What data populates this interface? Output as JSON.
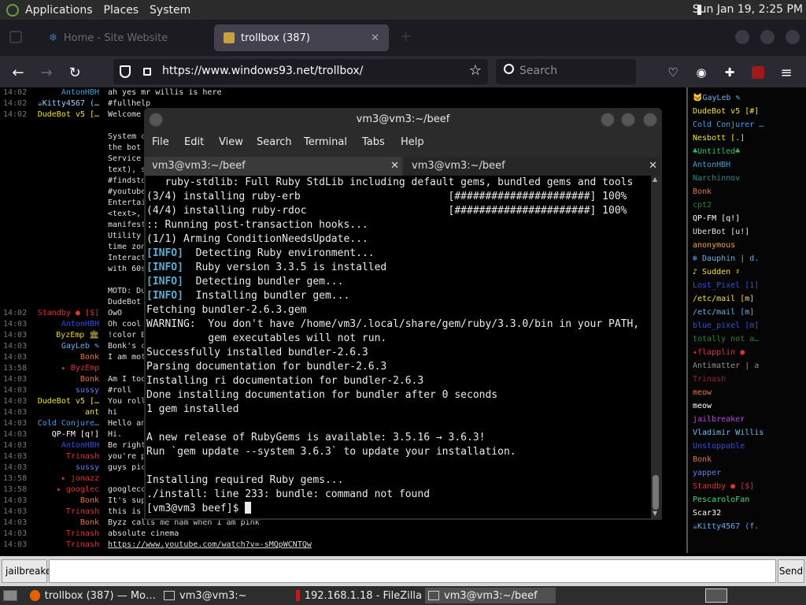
{
  "topbar": {
    "apps": "Applications",
    "places": "Places",
    "system": "System",
    "clock": "Sun Jan 19,  2:25 PM"
  },
  "browser": {
    "tab_inactive": "Home - Site Website",
    "tab_active": "trollbox (387)",
    "url": "https://www.windows93.net/trollbox/",
    "search_placeholder": "Search"
  },
  "chat": {
    "lines": [
      {
        "ts": "14:02",
        "nick": "AntonHBH",
        "color": "#3aa0d8",
        "msg": "ah yes mr willis is here"
      },
      {
        "ts": "14:02",
        "nick": "☕Kitty4567 (…",
        "color": "#9ad0ff",
        "msg": "#fullhelp"
      },
      {
        "ts": "14:02",
        "nick": "DudeBot v5 […",
        "color": "#f0e030",
        "msg": "Welcome to the trollbox…"
      },
      {
        "ts": "",
        "nick": "",
        "color": "#fff",
        "msg": ""
      },
      {
        "ts": "",
        "nick": "",
        "color": "#fff",
        "msg": "System c"
      },
      {
        "ts": "",
        "nick": "",
        "color": "#fff",
        "msg": "the bot"
      },
      {
        "ts": "",
        "nick": "",
        "color": "#fff",
        "msg": "Service"
      },
      {
        "ts": "",
        "nick": "",
        "color": "#fff",
        "msg": "text), s"
      },
      {
        "ts": "",
        "nick": "",
        "color": "#fff",
        "msg": "#findsto"
      },
      {
        "ts": "",
        "nick": "",
        "color": "#fff",
        "msg": "#youtube"
      },
      {
        "ts": "",
        "nick": "",
        "color": "#fff",
        "msg": "Entertai"
      },
      {
        "ts": "",
        "nick": "",
        "color": "#fff",
        "msg": "<text>,"
      },
      {
        "ts": "",
        "nick": "",
        "color": "#fff",
        "msg": "manifest"
      },
      {
        "ts": "",
        "nick": "",
        "color": "#fff",
        "msg": "Utility"
      },
      {
        "ts": "",
        "nick": "",
        "color": "#fff",
        "msg": "time zon"
      },
      {
        "ts": "",
        "nick": "",
        "color": "#fff",
        "msg": "Interact"
      },
      {
        "ts": "",
        "nick": "",
        "color": "#fff",
        "msg": "with 60s"
      },
      {
        "ts": "",
        "nick": "",
        "color": "#fff",
        "msg": ""
      },
      {
        "ts": "",
        "nick": "",
        "color": "#fff",
        "msg": "MOTD: Du"
      },
      {
        "ts": "",
        "nick": "",
        "color": "#fff",
        "msg": "DudeBot"
      },
      {
        "ts": "14:02",
        "nick": "Standby ● [$]",
        "color": "#e03030",
        "msg": "OwO"
      },
      {
        "ts": "14:03",
        "nick": "AntonHBH",
        "color": "#3050e0",
        "msg": "Oh cool"
      },
      {
        "ts": "14:03",
        "nick": "ByzEmp 🏛",
        "color": "#e0d030",
        "msg": "!color B"
      },
      {
        "ts": "14:03",
        "nick": "GayLeb ✎",
        "color": "#60b0f0",
        "msg": "Bonk's c"
      },
      {
        "ts": "14:03",
        "nick": "Bonk",
        "color": "#f07030",
        "msg": "I am mot"
      },
      {
        "ts": "13:58",
        "nick": "▸ ByzEmp",
        "color": "#e03030",
        "msg": ""
      },
      {
        "ts": "14:03",
        "nick": "Bonk",
        "color": "#f07030",
        "msg": "Am I too"
      },
      {
        "ts": "14:03",
        "nick": "sussy",
        "color": "#6080f0",
        "msg": "#roll"
      },
      {
        "ts": "14:03",
        "nick": "DudeBot v5 […",
        "color": "#f0e030",
        "msg": "You roll"
      },
      {
        "ts": "14:03",
        "nick": "ant",
        "color": "#f0e030",
        "msg": "hi"
      },
      {
        "ts": "14:03",
        "nick": "Cold Conjure…",
        "color": "#3aa0f0",
        "msg": "Hello an"
      },
      {
        "ts": "14:03",
        "nick": "QP-FM [q!]",
        "color": "#ffffff",
        "msg": "Hi."
      },
      {
        "ts": "14:03",
        "nick": "AntonHBH",
        "color": "#3050e0",
        "msg": "Be right"
      },
      {
        "ts": "14:03",
        "nick": "Trinash",
        "color": "#e03030",
        "msg": "you're p"
      },
      {
        "ts": "14:03",
        "nick": "sussy",
        "color": "#6080f0",
        "msg": "guys pic"
      },
      {
        "ts": "13:58",
        "nick": "▸ jonazz",
        "color": "#e03030",
        "msg": ""
      },
      {
        "ts": "13:58",
        "nick": "▸ googlec",
        "color": "#e03030",
        "msg": "googleco"
      },
      {
        "ts": "14:03",
        "nick": "Bonk",
        "color": "#f07030",
        "msg": "It's sup"
      },
      {
        "ts": "14:03",
        "nick": "Trinash",
        "color": "#e03030",
        "msg": "this is"
      },
      {
        "ts": "14:03",
        "nick": "Bonk",
        "color": "#f07030",
        "msg": "Byzz calls me ham when I am pink"
      },
      {
        "ts": "14:03",
        "nick": "Trinash",
        "color": "#e03030",
        "msg": "absolute cinema"
      },
      {
        "ts": "14:03",
        "nick": "Trinash",
        "color": "#e03030",
        "msg": "https://www.youtube.com/watch?v=-sMQpWCNTQw"
      }
    ],
    "users": [
      {
        "name": "🐱GayLeb ✎",
        "color": "#60b0f0"
      },
      {
        "name": "DudeBot v5 [#]",
        "color": "#f0e030"
      },
      {
        "name": "Cold Conjurer …",
        "color": "#3aa0f0"
      },
      {
        "name": "Nesbott [.]",
        "color": "#f0e030"
      },
      {
        "name": "♣Untitled♣",
        "color": "#30c060"
      },
      {
        "name": "AntonHBH",
        "color": "#3aa0d8"
      },
      {
        "name": "Narchinnov",
        "color": "#2a8a8a"
      },
      {
        "name": "Bonk",
        "color": "#f07030"
      },
      {
        "name": "cpt2",
        "color": "#308030"
      },
      {
        "name": "QP-FM [q!]",
        "color": "#ffffff"
      },
      {
        "name": "UberBot [u!]",
        "color": "#e0e0e0"
      },
      {
        "name": "anonymous",
        "color": "#f0a030"
      },
      {
        "name": "❄ Dauphin | d.",
        "color": "#60b0f0"
      },
      {
        "name": "♪ Sudden ♯",
        "color": "#f0e030"
      },
      {
        "name": "Lost_Pixel [1]",
        "color": "#3050e0"
      },
      {
        "name": "/etc/mail [m]",
        "color": "#f0e030"
      },
      {
        "name": "/etc/mail [m]",
        "color": "#60b0f0"
      },
      {
        "name": "blue_pixel [m]",
        "color": "#3050e0"
      },
      {
        "name": "totally not a…",
        "color": "#308030"
      },
      {
        "name": "✦flapplin ●",
        "color": "#e03030"
      },
      {
        "name": "Antimatter | a",
        "color": "#909090"
      },
      {
        "name": "Trinash",
        "color": "#a02020"
      },
      {
        "name": "meow",
        "color": "#f07030"
      },
      {
        "name": "meow",
        "color": "#ffffff"
      },
      {
        "name": "jailbreaker",
        "color": "#c040e0"
      },
      {
        "name": "Vladimir Willis",
        "color": "#60c0f0"
      },
      {
        "name": "Unstoppable",
        "color": "#3050e0"
      },
      {
        "name": "Bonk",
        "color": "#f07030"
      },
      {
        "name": "yapper",
        "color": "#6080f0"
      },
      {
        "name": "Standby ● [$]",
        "color": "#e03030"
      },
      {
        "name": "PescaroloFan",
        "color": "#30e080"
      },
      {
        "name": "Scar32",
        "color": "#ffffff"
      },
      {
        "name": "☕Kitty4567 (f.",
        "color": "#60b0f0"
      }
    ],
    "input_nick": "jailbreaker",
    "send": "Send"
  },
  "terminal": {
    "title": "vm3@vm3:~/beef",
    "menu": [
      "File",
      "Edit",
      "View",
      "Search",
      "Terminal",
      "Tabs",
      "Help"
    ],
    "tabs": [
      "vm3@vm3:~/beef",
      "vm3@vm3:~/beef"
    ],
    "lines": [
      {
        "t": "   ruby-stdlib: Full Ruby StdLib including default gems, bundled gems and tools"
      },
      {
        "t": "(3/4) installing ruby-erb                        [######################] 100%"
      },
      {
        "t": "(4/4) installing ruby-rdoc                       [######################] 100%"
      },
      {
        "t": ":: Running post-transaction hooks..."
      },
      {
        "t": "(1/1) Arming ConditionNeedsUpdate..."
      },
      {
        "tag": "[INFO]",
        "t": "  Detecting Ruby environment..."
      },
      {
        "tag": "[INFO]",
        "t": "  Ruby version 3.3.5 is installed"
      },
      {
        "tag": "[INFO]",
        "t": "  Detecting bundler gem..."
      },
      {
        "tag": "[INFO]",
        "t": "  Installing bundler gem..."
      },
      {
        "t": "Fetching bundler-2.6.3.gem"
      },
      {
        "t": "WARNING:  You don't have /home/vm3/.local/share/gem/ruby/3.3.0/bin in your PATH,"
      },
      {
        "t": "          gem executables will not run."
      },
      {
        "t": "Successfully installed bundler-2.6.3"
      },
      {
        "t": "Parsing documentation for bundler-2.6.3"
      },
      {
        "t": "Installing ri documentation for bundler-2.6.3"
      },
      {
        "t": "Done installing documentation for bundler after 0 seconds"
      },
      {
        "t": "1 gem installed"
      },
      {
        "t": ""
      },
      {
        "t": "A new release of RubyGems is available: 3.5.16 → 3.6.3!"
      },
      {
        "t": "Run `gem update --system 3.6.3` to update your installation."
      },
      {
        "t": ""
      },
      {
        "t": "Installing required Ruby gems..."
      },
      {
        "t": "./install: line 233: bundle: command not found"
      },
      {
        "t": "[vm3@vm3 beef]$ ",
        "cursor": true
      }
    ]
  },
  "taskbar": {
    "items": [
      "trollbox (387) — Mo…",
      "vm3@vm3:~",
      "192.168.1.18 - FileZilla",
      "vm3@vm3:~/beef"
    ]
  }
}
